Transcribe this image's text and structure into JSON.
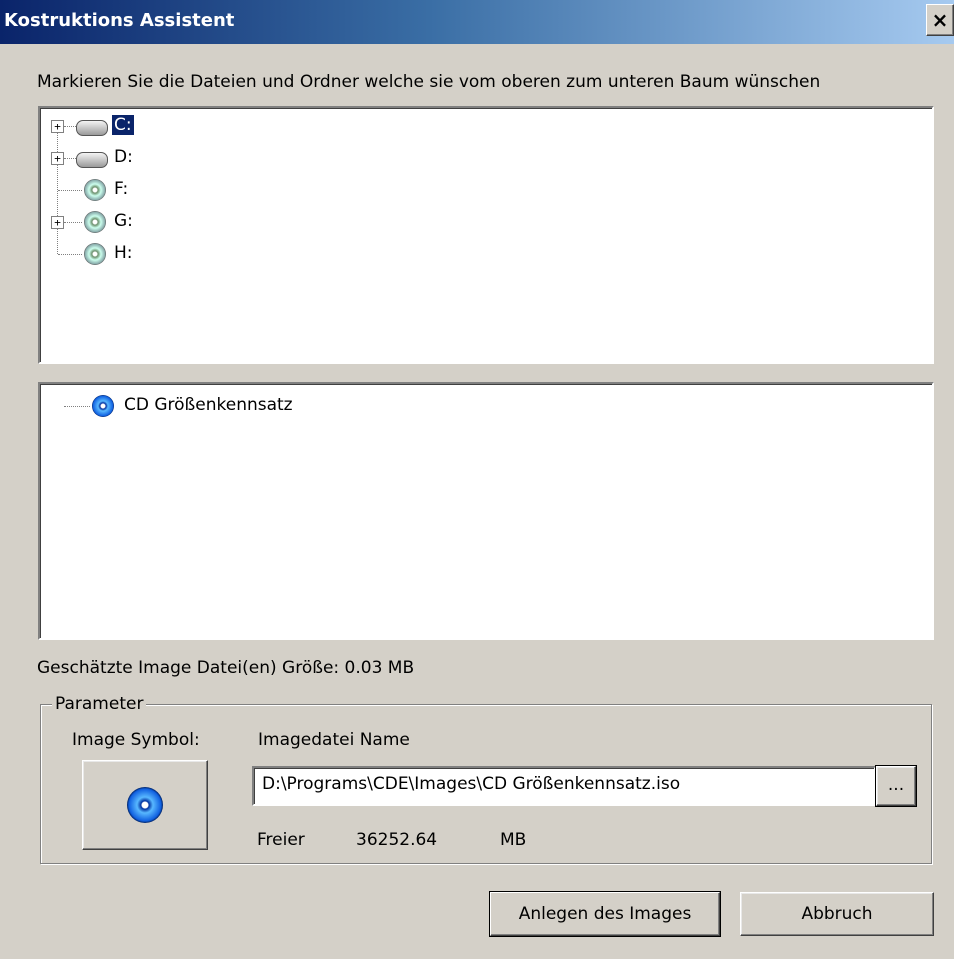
{
  "window": {
    "title": "Kostruktions Assistent",
    "close_label": "×"
  },
  "instruction": "Markieren Sie die Dateien und Ordner welche sie vom oberen zum unteren Baum wünschen",
  "source_tree": {
    "nodes": [
      {
        "label": "C:",
        "icon": "hard-drive-icon",
        "expandable": true,
        "selected": true
      },
      {
        "label": "D:",
        "icon": "hard-drive-icon",
        "expandable": true,
        "selected": false
      },
      {
        "label": "F:",
        "icon": "cd-drive-icon",
        "expandable": false,
        "selected": false
      },
      {
        "label": "G:",
        "icon": "cd-drive-icon",
        "expandable": true,
        "selected": false
      },
      {
        "label": "H:",
        "icon": "cd-drive-icon",
        "expandable": false,
        "selected": false
      }
    ],
    "expander_symbol": "+"
  },
  "target_tree": {
    "root": {
      "label": "CD Größenkennsatz",
      "icon": "cd-disc-icon"
    }
  },
  "estimated_size": "Geschätzte Image Datei(en) Größe: 0.03 MB",
  "parameter": {
    "legend": "Parameter",
    "image_symbol_label": "Image Symbol:",
    "file_name_label": "Imagedatei Name",
    "file_path": "D:\\Programs\\CDE\\Images\\CD Größenkennsatz.iso",
    "browse_label": "...",
    "free_label": "Freier",
    "free_value": "36252.64",
    "free_unit": "MB"
  },
  "buttons": {
    "create": "Anlegen des Images",
    "cancel": "Abbruch"
  }
}
